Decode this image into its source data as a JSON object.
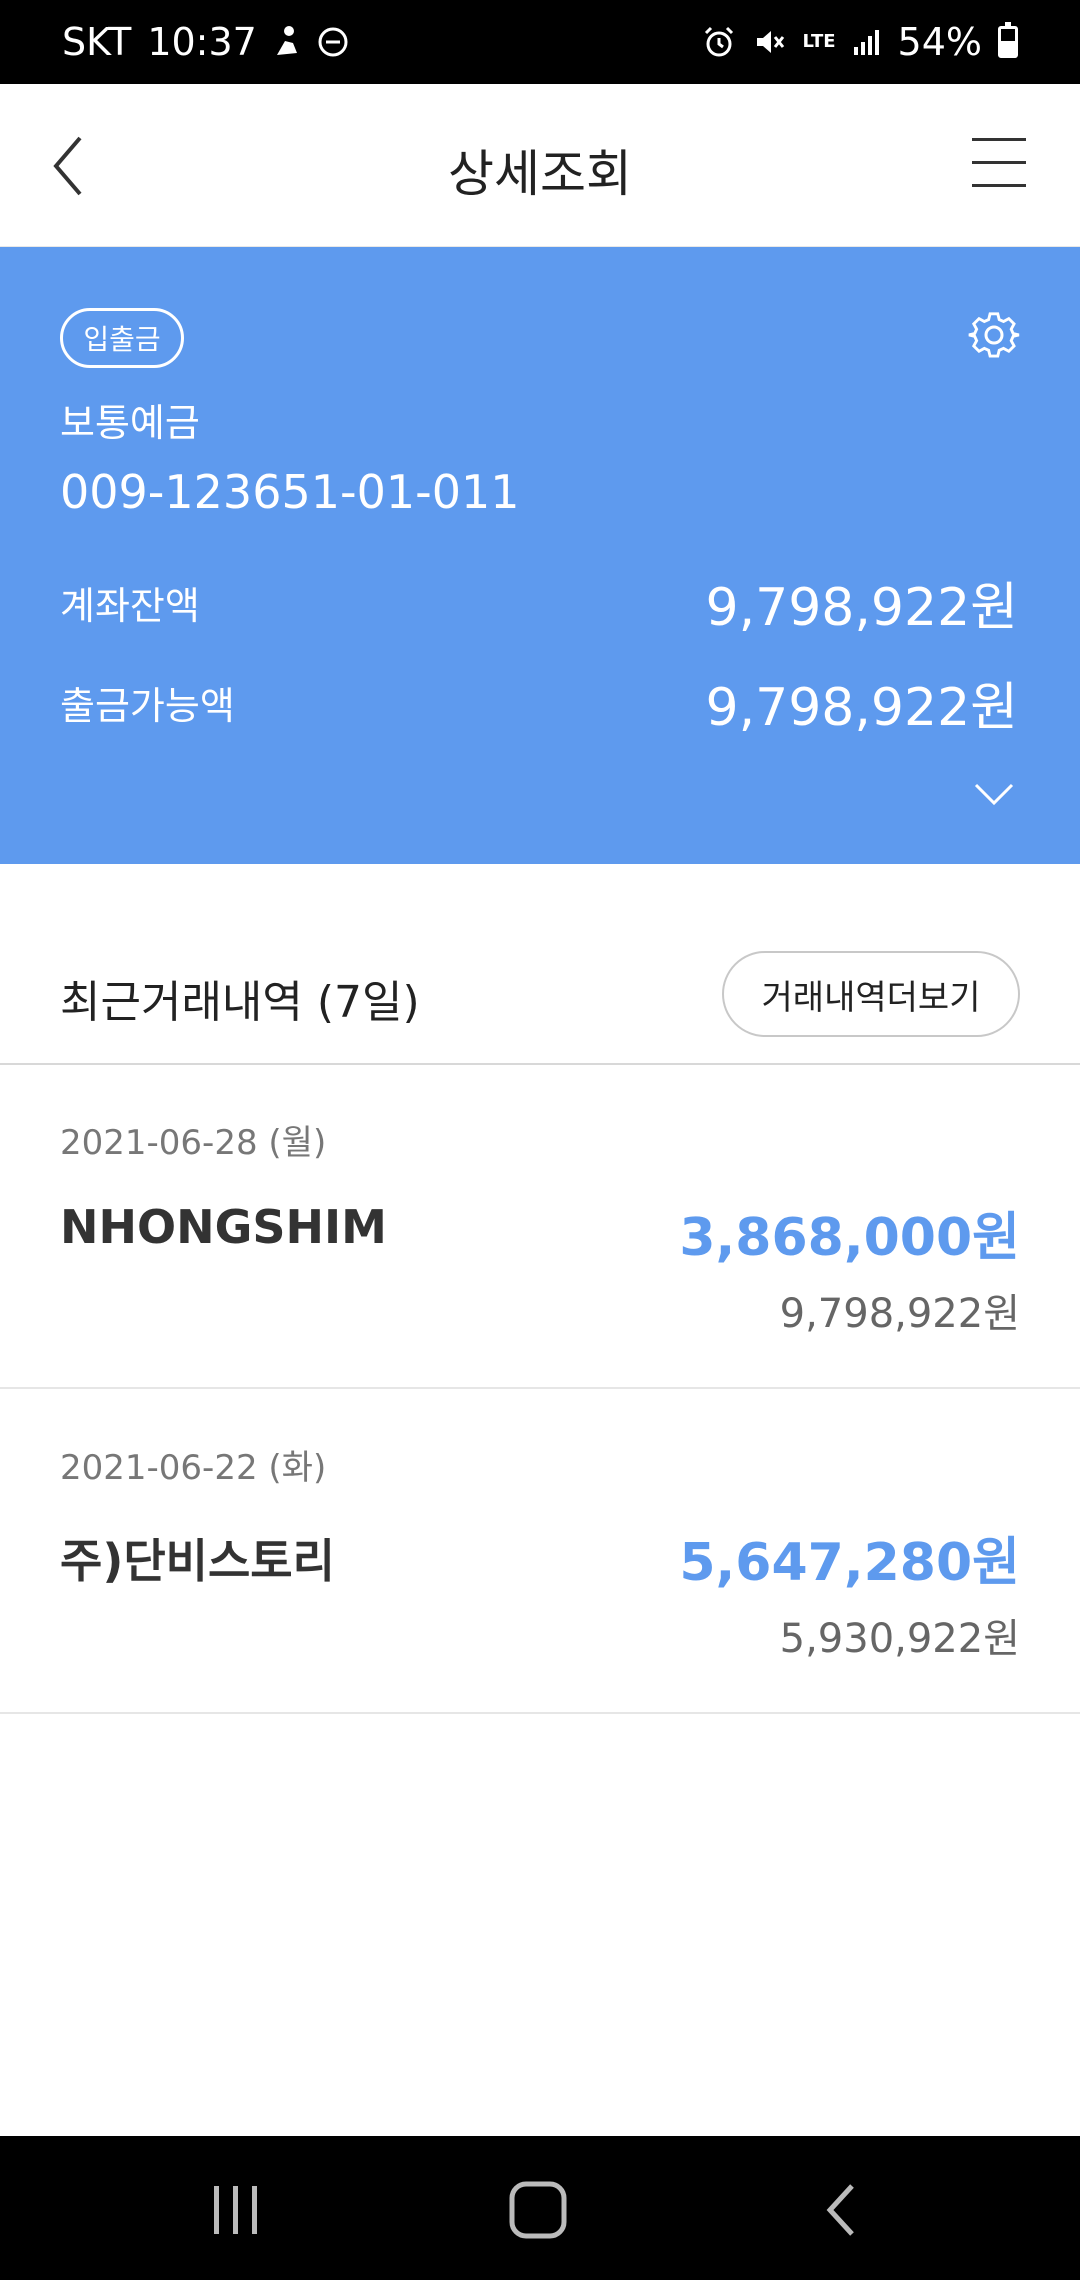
{
  "status_bar": {
    "carrier": "SKT",
    "time": "10:37",
    "network": "LTE",
    "battery": "54%",
    "icons": [
      "alarm-icon",
      "mute-icon",
      "signal-icon",
      "battery-icon",
      "dnd-icon",
      "person-icon"
    ]
  },
  "header": {
    "title": "상세조회"
  },
  "account": {
    "type_badge": "입출금",
    "name": "보통예금",
    "number": "009-123651-01-011",
    "balance_label": "계좌잔액",
    "balance_value": "9,798,922원",
    "available_label": "출금가능액",
    "available_value": "9,798,922원"
  },
  "recent": {
    "title": "최근거래내역 (7일)",
    "more_button": "거래내역더보기",
    "transactions": [
      {
        "date": "2021-06-28 (월)",
        "name": "NHONGSHIM",
        "amount": "3,868,000원",
        "balance": "9,798,922원"
      },
      {
        "date": "2021-06-22 (화)",
        "name": "주)단비스토리",
        "amount": "5,647,280원",
        "balance": "5,930,922원"
      }
    ]
  },
  "colors": {
    "accent": "#5e9aee",
    "text_dark": "#333333",
    "text_muted": "#777777"
  }
}
